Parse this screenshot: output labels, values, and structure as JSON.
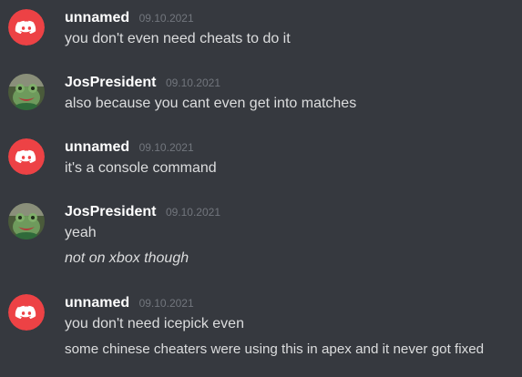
{
  "accent": {
    "discord_red": "#ed4245",
    "background": "#36393f",
    "username": "#ffffff",
    "timestamp": "#72767d",
    "text": "#dcddde"
  },
  "messages": [
    {
      "author": "unnamed",
      "avatar_icon": "discord-logo-icon",
      "timestamp": "09.10.2021",
      "lines": [
        {
          "text": "you don't even need cheats to do it",
          "italic": false
        }
      ]
    },
    {
      "author": "JosPresident",
      "avatar_icon": "frog-avatar-icon",
      "timestamp": "09.10.2021",
      "lines": [
        {
          "text": "also because you cant even get into matches",
          "italic": false
        }
      ]
    },
    {
      "author": "unnamed",
      "avatar_icon": "discord-logo-icon",
      "timestamp": "09.10.2021",
      "lines": [
        {
          "text": "it's a console command",
          "italic": false
        }
      ]
    },
    {
      "author": "JosPresident",
      "avatar_icon": "frog-avatar-icon",
      "timestamp": "09.10.2021",
      "lines": [
        {
          "text": "yeah",
          "italic": false
        },
        {
          "text": "not on xbox though",
          "italic": true
        }
      ]
    },
    {
      "author": "unnamed",
      "avatar_icon": "discord-logo-icon",
      "timestamp": "09.10.2021",
      "lines": [
        {
          "text": "you don't need icepick even",
          "italic": false
        },
        {
          "text": "some chinese cheaters were using this in apex and it never got fixed",
          "italic": false
        }
      ]
    }
  ]
}
